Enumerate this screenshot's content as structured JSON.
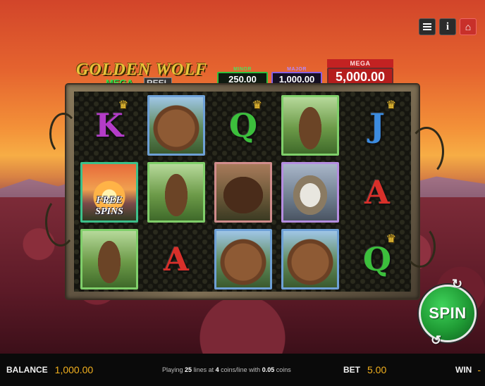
{
  "game": {
    "logo_title": "GOLDEN WOLF",
    "logo_mega": "MEGA",
    "logo_reel": "REEL"
  },
  "top_controls": {
    "menu_icon": "menu-icon",
    "info_icon": "info-icon",
    "info_symbol": "i",
    "home_icon": "home-icon",
    "home_symbol": "⌂"
  },
  "jackpots": {
    "minor": {
      "label": "MINOR",
      "value": "250.00"
    },
    "major": {
      "label": "MAJOR",
      "value": "1,000.00"
    },
    "mega": {
      "label": "MEGA",
      "value": "5,000.00"
    }
  },
  "reels": {
    "free_spins_label": "FREE SPINS",
    "symbols": [
      {
        "row": 1,
        "col": 1,
        "type": "letter",
        "text": "K",
        "color": "#b43cc8",
        "crown": true
      },
      {
        "row": 1,
        "col": 2,
        "type": "bear"
      },
      {
        "row": 1,
        "col": 3,
        "type": "letter",
        "text": "Q",
        "color": "#3cbf3c",
        "crown": true
      },
      {
        "row": 1,
        "col": 4,
        "type": "horse"
      },
      {
        "row": 1,
        "col": 5,
        "type": "letter",
        "text": "J",
        "color": "#3c8ce0",
        "crown": true
      },
      {
        "row": 2,
        "col": 1,
        "type": "free_spins"
      },
      {
        "row": 2,
        "col": 2,
        "type": "horse"
      },
      {
        "row": 2,
        "col": 3,
        "type": "bison"
      },
      {
        "row": 2,
        "col": 4,
        "type": "eagle"
      },
      {
        "row": 2,
        "col": 5,
        "type": "letter",
        "text": "A",
        "color": "#d8302a",
        "crown": false
      },
      {
        "row": 3,
        "col": 1,
        "type": "horse"
      },
      {
        "row": 3,
        "col": 2,
        "type": "letter",
        "text": "A",
        "color": "#d8302a",
        "crown": false
      },
      {
        "row": 3,
        "col": 3,
        "type": "bear"
      },
      {
        "row": 3,
        "col": 4,
        "type": "bear"
      },
      {
        "row": 3,
        "col": 5,
        "type": "letter",
        "text": "Q",
        "color": "#3cbf3c",
        "crown": true
      }
    ]
  },
  "spin": {
    "label": "SPIN"
  },
  "bottom_bar": {
    "balance_label": "BALANCE",
    "balance_value": "1,000.00",
    "info_prefix": "Playing",
    "lines": "25",
    "info_mid1": "lines at",
    "coins": "4",
    "info_mid2": "coins/line with",
    "coin_value": "0.05",
    "info_suffix": "coins",
    "bet_label": "BET",
    "bet_value": "5.00",
    "win_label": "WIN",
    "win_value": "-"
  },
  "colors": {
    "accent_gold": "#f2b01e",
    "spin_green": "#1f9a34",
    "mega_red": "#b51d1d"
  }
}
